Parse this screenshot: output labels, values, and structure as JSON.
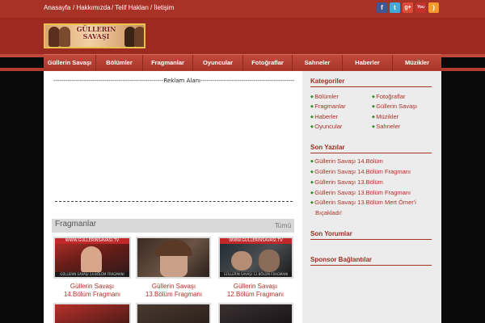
{
  "topbar": {
    "links": [
      "Anasayfa",
      "/ Hakkımızda",
      "/ Telif Hakları",
      "/ İletişim"
    ],
    "social": [
      {
        "icon": "facebook-icon",
        "glyph": "f",
        "color": "#3b5998"
      },
      {
        "icon": "twitter-icon",
        "glyph": "t",
        "color": "#3fa9e0"
      },
      {
        "icon": "googleplus-icon",
        "glyph": "g+",
        "color": "#dd4b39"
      },
      {
        "icon": "youtube-icon",
        "glyph": "You",
        "color": "#c4302b"
      },
      {
        "icon": "rss-icon",
        "glyph": ")",
        "color": "#f39a2b"
      }
    ]
  },
  "logo": {
    "text": "GÜLLERIN SAVAŞI"
  },
  "nav": [
    "Güllerin Savaşı",
    "Bölümler",
    "Fragmanlar",
    "Oyuncular",
    "Fotoğraflar",
    "Sahneler",
    "Haberler",
    "Müzikler"
  ],
  "ad": {
    "label": "------------------------------------------------------Reklam Alanı------------------------------------------------------------------------------------------"
  },
  "fragmanlar": {
    "title": "Fragmanlar",
    "all_link": "Tümü",
    "items": [
      {
        "line1": "Güllerin Savaşı",
        "line2": "14.Bölüm Fragmanı"
      },
      {
        "line1": "Güllerin Savaşı",
        "line2": "13.Bölüm Fragmanı"
      },
      {
        "line1": "Güllerin Savaşı",
        "line2": "12.Bölüm Fragmanı"
      }
    ]
  },
  "sidebar": {
    "kategoriler": {
      "title": "Kategoriler",
      "left": [
        "Bölümler",
        "Fragmanlar",
        "Haberler",
        "Oyuncular"
      ],
      "right": [
        "Fotoğraflar",
        "Güllerin Savaşı",
        "Müzikler",
        "Sahneler"
      ]
    },
    "son_yazilar": {
      "title": "Son Yazılar",
      "items": [
        "Güllerin Savaşı 14.Bölüm",
        "Güllerin Savaşı 14.Bölüm Fragmanı",
        "Güllerin Savaşı 13.Bölüm",
        "Güllerin Savaşı 13.Bölüm Fragmanı",
        "Güllerin Savaşı 13.Bölüm Mert Ömer'i",
        "Bıçakladı!"
      ]
    },
    "son_yorumlar": {
      "title": "Son Yorumlar"
    },
    "sponsor": {
      "title": "Sponsor Bağlantılar"
    }
  }
}
